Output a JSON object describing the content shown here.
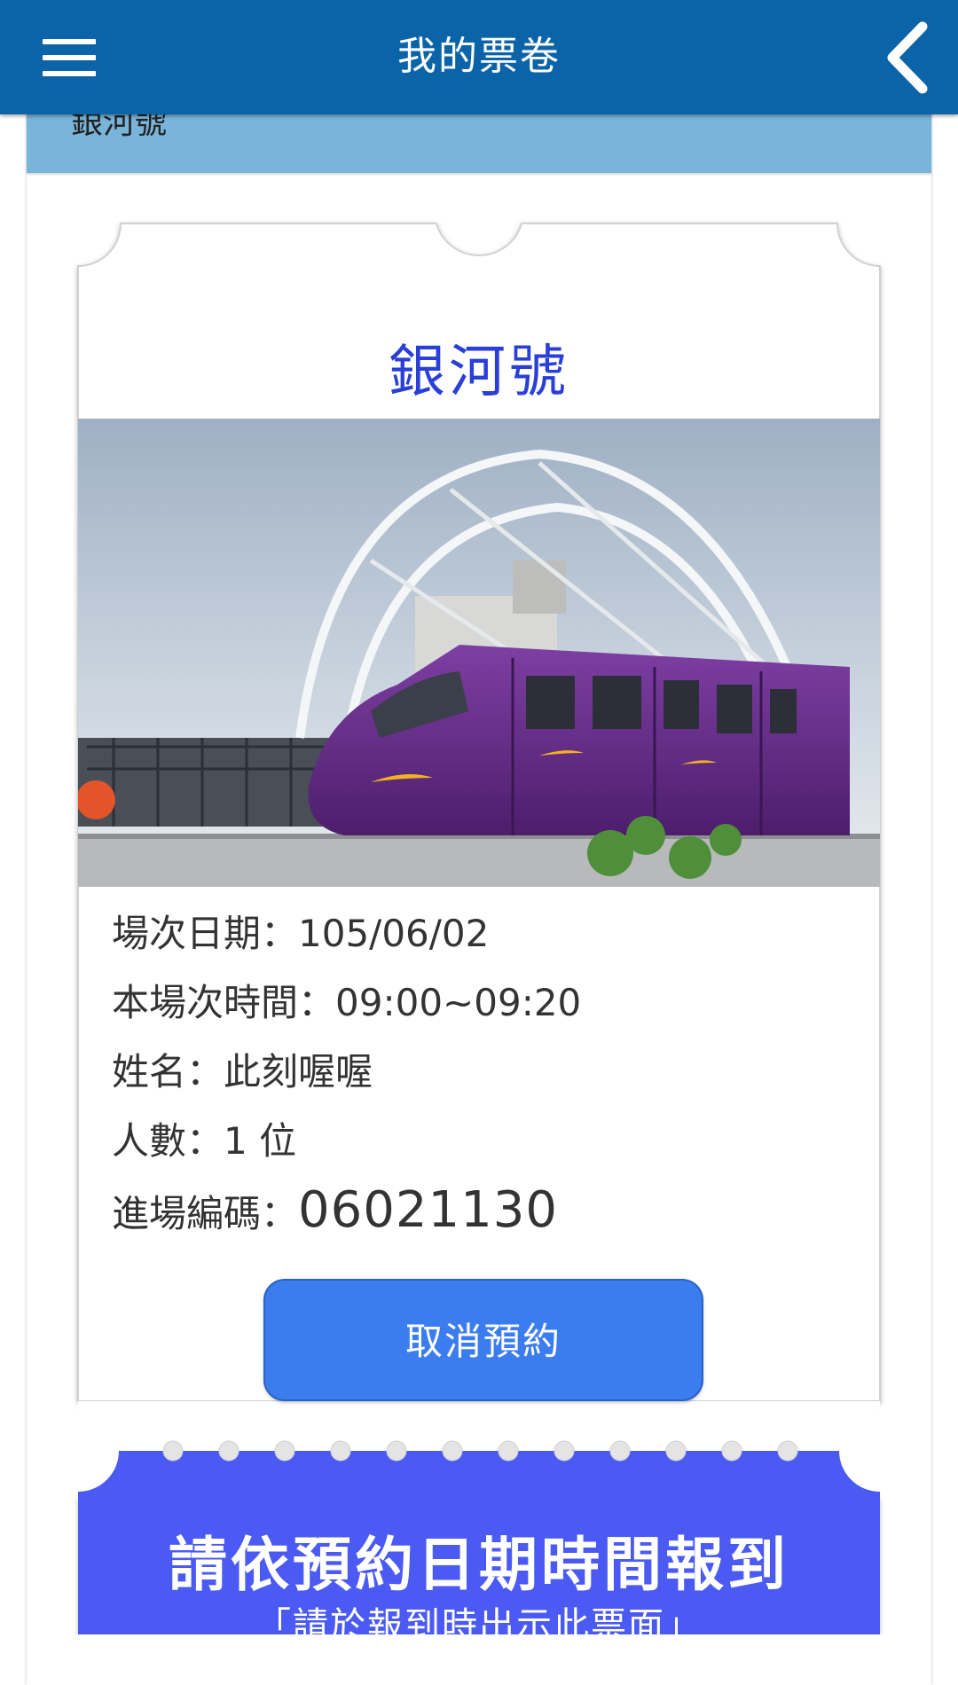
{
  "appbar": {
    "title": "我的票卷",
    "menu_icon": "hamburger-menu-icon",
    "back_icon": "chevron-left-icon",
    "bg_color": "#0b64a8"
  },
  "section": {
    "label": "銀河號"
  },
  "ticket": {
    "title": "銀河號",
    "image_description": "purple-monorail-train",
    "info": [
      {
        "label": "場次日期：",
        "value": "105/06/02"
      },
      {
        "label": "本場次時間：",
        "value": "09:00~09:20"
      },
      {
        "label": "姓名：",
        "value": "此刻喔喔"
      },
      {
        "label": "人數：",
        "value": "1 位"
      },
      {
        "label": "進場編碼：",
        "value": "06021130"
      }
    ],
    "cancel_label": "取消預約",
    "notice_title": "請依預約日期時間報到",
    "notice_sub": "「請於報到時出示此票面」",
    "accent_color": "#2a3fd8",
    "notice_color": "#4a5af2",
    "button_color": "#3b7def"
  }
}
